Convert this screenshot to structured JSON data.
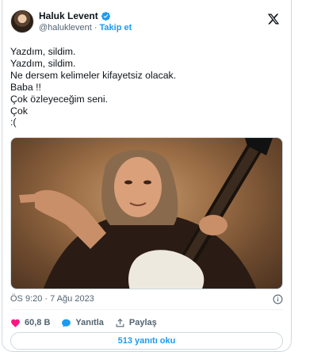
{
  "author": {
    "name": "Haluk Levent",
    "handle": "@haluklevent",
    "separator": "·",
    "follow_label": "Takip et"
  },
  "tweet": {
    "lines": [
      "Yazdım, sildim.",
      "Yazdım, sildim.",
      "Ne dersem kelimeler kifayetsiz olacak.",
      "Baba !!",
      "Çok özleyeceğim seni.",
      "Çok",
      ":("
    ],
    "timestamp": "ÖS 9:20 · 7 Ağu 2023"
  },
  "actions": {
    "like_count": "60,8 B",
    "reply_label": "Yanıtla",
    "share_label": "Paylaş"
  },
  "replies_button_label": "513 yanıtı oku",
  "colors": {
    "accent": "#1d9bf0",
    "like": "#f91880",
    "text": "#0f1419",
    "muted": "#536471",
    "border": "#cfd9de"
  },
  "icons": [
    "verified-badge-icon",
    "x-logo-icon",
    "info-icon",
    "heart-icon",
    "reply-bubble-icon",
    "share-icon"
  ]
}
